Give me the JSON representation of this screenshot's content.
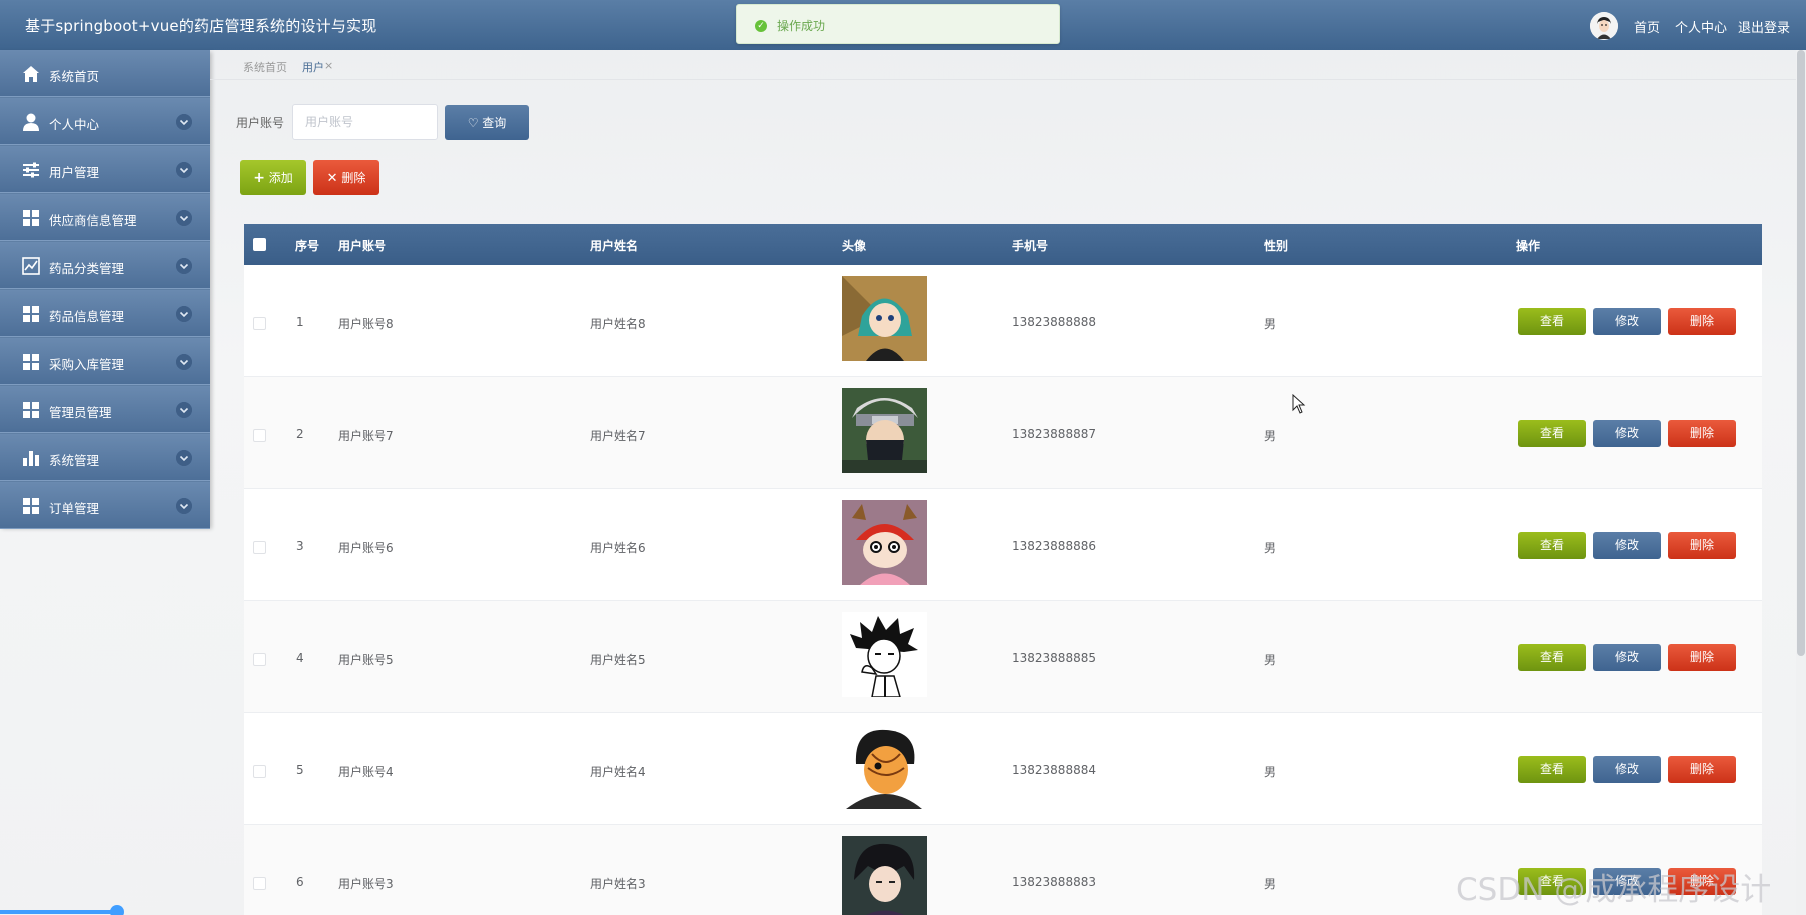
{
  "header": {
    "title": "基于springboot+vue的药店管理系统的设计与实现",
    "toast": "操作成功",
    "links": [
      "首页",
      "个人中心",
      "退出登录"
    ]
  },
  "sidebar": {
    "items": [
      {
        "label": "系统首页",
        "icon": "home-icon"
      },
      {
        "label": "个人中心",
        "icon": "user-icon"
      },
      {
        "label": "用户管理",
        "icon": "sliders-icon"
      },
      {
        "label": "供应商信息管理",
        "icon": "grid-icon"
      },
      {
        "label": "药品分类管理",
        "icon": "chart-line-icon"
      },
      {
        "label": "药品信息管理",
        "icon": "grid-icon"
      },
      {
        "label": "采购入库管理",
        "icon": "grid-icon"
      },
      {
        "label": "管理员管理",
        "icon": "grid-icon"
      },
      {
        "label": "系统管理",
        "icon": "bar-chart-icon"
      },
      {
        "label": "订单管理",
        "icon": "grid-icon"
      }
    ]
  },
  "breadcrumb": {
    "home": "系统首页",
    "current": "用户",
    "close": "×"
  },
  "search": {
    "label": "用户账号",
    "placeholder": "用户账号",
    "value": "",
    "button": "查询"
  },
  "actions": {
    "add": "添加",
    "delete": "删除"
  },
  "table": {
    "columns": [
      "序号",
      "用户账号",
      "用户姓名",
      "头像",
      "手机号",
      "性别",
      "操作"
    ],
    "row_actions": {
      "view": "查看",
      "edit": "修改",
      "delete": "删除"
    },
    "rows": [
      {
        "index": "1",
        "account": "用户账号8",
        "name": "用户姓名8",
        "phone": "13823888888",
        "gender": "男"
      },
      {
        "index": "2",
        "account": "用户账号7",
        "name": "用户姓名7",
        "phone": "13823888887",
        "gender": "男"
      },
      {
        "index": "3",
        "account": "用户账号6",
        "name": "用户姓名6",
        "phone": "13823888886",
        "gender": "男"
      },
      {
        "index": "4",
        "account": "用户账号5",
        "name": "用户姓名5",
        "phone": "13823888885",
        "gender": "男"
      },
      {
        "index": "5",
        "account": "用户账号4",
        "name": "用户姓名4",
        "phone": "13823888884",
        "gender": "男"
      },
      {
        "index": "6",
        "account": "用户账号3",
        "name": "用户姓名3",
        "phone": "13823888883",
        "gender": "男"
      }
    ]
  },
  "watermark": "CSDN @成承程序设计",
  "colors": {
    "header": "#4a6e98",
    "view": "#8aae16",
    "edit": "#4a6e98",
    "delete": "#dc4428"
  }
}
